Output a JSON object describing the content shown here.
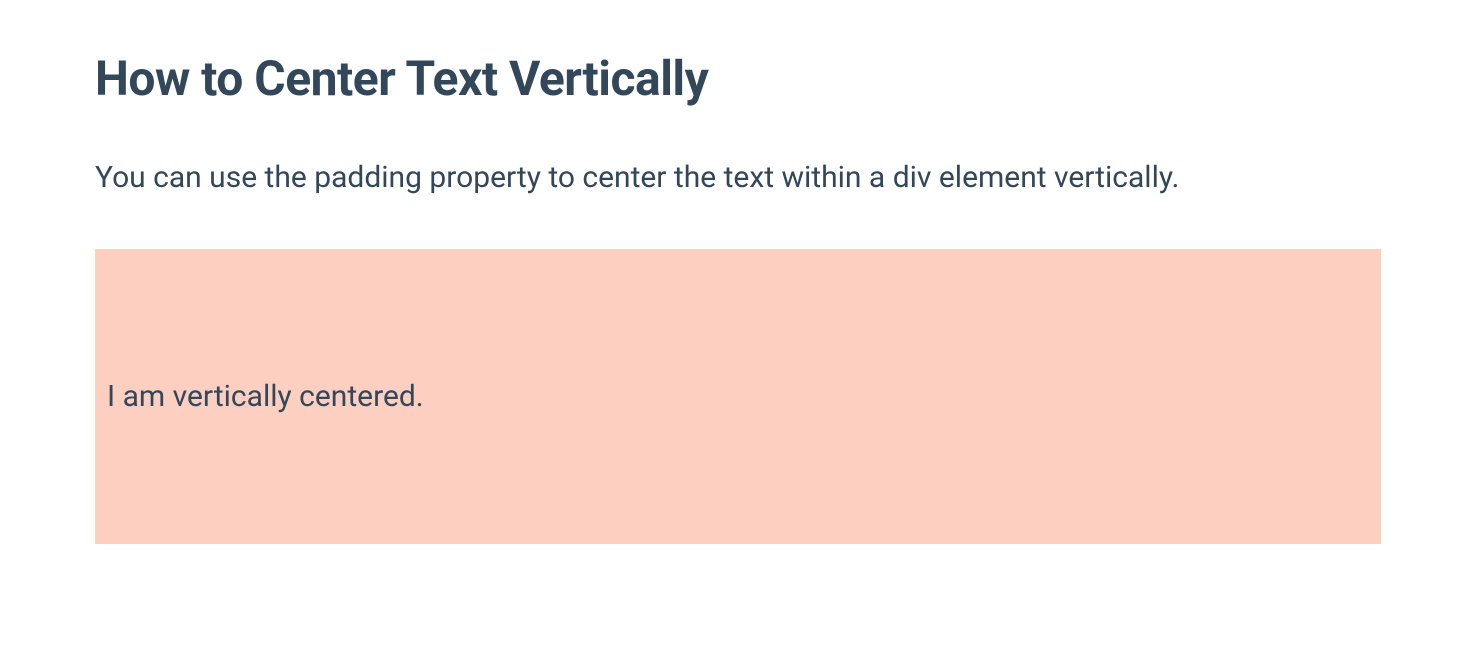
{
  "heading": "How to Center Text Vertically",
  "description": "You can use the padding property to center the text within a div element vertically.",
  "demo": {
    "text": "I am vertically centered."
  }
}
